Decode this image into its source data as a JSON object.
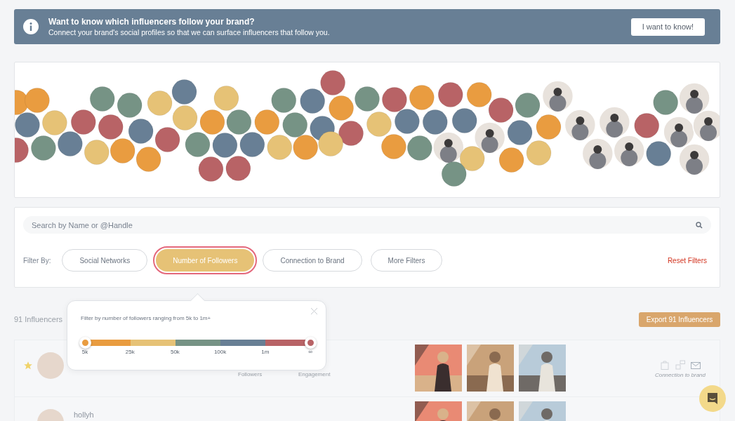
{
  "banner": {
    "title": "Want to know which influencers follow your brand?",
    "text": "Connect your brand's social profiles so that we can surface influencers that follow you.",
    "button": "I want to know!"
  },
  "search": {
    "placeholder": "Search by Name or @Handle"
  },
  "filter_label": "Filter By:",
  "filters": [
    {
      "label": "Social Networks",
      "selected": false
    },
    {
      "label": "Number of Followers",
      "selected": true
    },
    {
      "label": "Connection to Brand",
      "selected": false
    },
    {
      "label": "More Filters",
      "selected": false
    }
  ],
  "reset": "Reset Filters",
  "popover": {
    "text": "Filter by number of followers ranging from 5k to 1m+",
    "segments": [
      {
        "color": "#e99c40"
      },
      {
        "color": "#e6c276"
      },
      {
        "color": "#769385"
      },
      {
        "color": "#687f95"
      },
      {
        "color": "#b86366"
      }
    ],
    "ticks": [
      "5k",
      "25k",
      "50k",
      "100k",
      "1m",
      "∞"
    ],
    "handles": [
      {
        "level": 0
      },
      {
        "level": 1
      }
    ]
  },
  "count": "91 Influencers",
  "export": "Export 91 Influencers",
  "rows": [
    {
      "starred": true,
      "name": "",
      "followers_label": "Followers",
      "engagement_label": "Engagement",
      "connection_label": "Connection to brand"
    },
    {
      "starred": false,
      "name": "hollyh"
    }
  ]
}
